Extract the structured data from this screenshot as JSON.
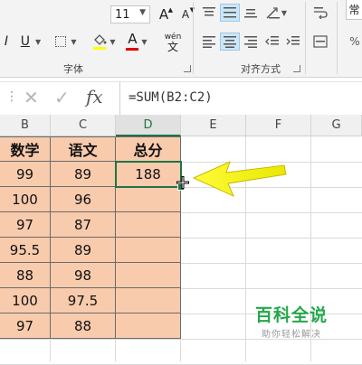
{
  "ribbon": {
    "font_size": "11",
    "grow_font": "A",
    "shrink_font": "A",
    "italic": "I",
    "underline": "U",
    "font_color_letter": "A",
    "wen_label": "wén",
    "wen_char": "文",
    "group_font_label": "字体",
    "group_align_label": "对齐方式",
    "right_partial": "常",
    "right_partial2": "%"
  },
  "formula_bar": {
    "fx": "fx",
    "formula": "=SUM(B2:C2)"
  },
  "columns": [
    "B",
    "C",
    "D",
    "E",
    "F",
    "G"
  ],
  "table": {
    "headers": [
      "数学",
      "语文",
      "总分"
    ],
    "rows": [
      [
        "99",
        "89",
        "188"
      ],
      [
        "100",
        "96",
        ""
      ],
      [
        "97",
        "87",
        ""
      ],
      [
        "95.5",
        "89",
        ""
      ],
      [
        "88",
        "98",
        ""
      ],
      [
        "100",
        "97.5",
        ""
      ],
      [
        "97",
        "88",
        ""
      ]
    ]
  },
  "colors": {
    "cell_fill": "#f8cbad",
    "selection": "#217346",
    "arrow": "#f2f200"
  },
  "watermark": {
    "title": "百科全说",
    "subtitle": "助你轻松解决"
  }
}
